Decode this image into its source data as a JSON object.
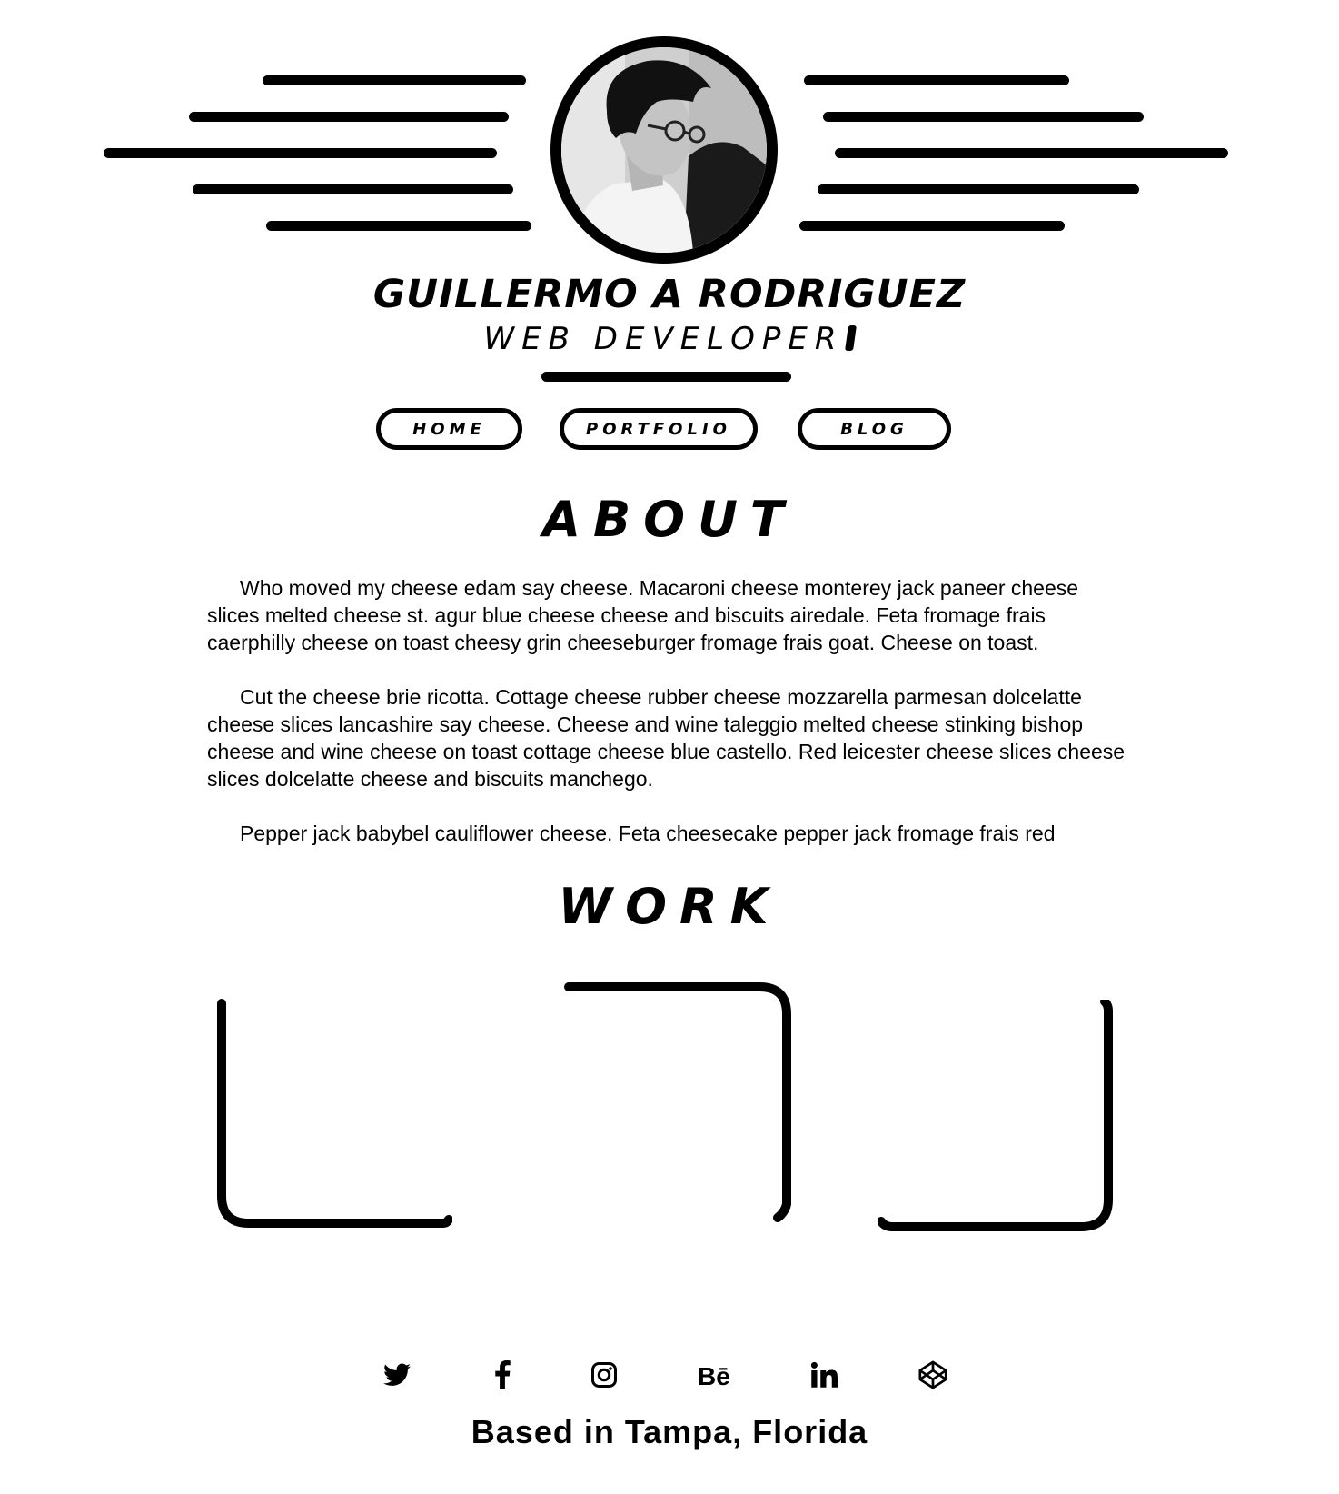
{
  "header": {
    "name": "GUILLERMO A RODRIGUEZ",
    "subtitle": "WEB DEVELOPER"
  },
  "nav": {
    "items": [
      {
        "label": "HOME"
      },
      {
        "label": "PORTFOLIO"
      },
      {
        "label": "BLOG"
      }
    ]
  },
  "about": {
    "title": "ABOUT",
    "paragraphs": [
      "Who moved my cheese edam say cheese. Macaroni cheese monterey jack paneer cheese slices melted cheese st. agur blue cheese cheese and biscuits airedale. Feta fromage frais caerphilly cheese on toast cheesy grin cheeseburger fromage frais goat. Cheese on toast.",
      "Cut the cheese brie ricotta. Cottage cheese rubber cheese mozzarella parmesan dolcelatte cheese slices lancashire say cheese. Cheese and wine taleggio melted cheese stinking bishop cheese and wine cheese on toast cottage cheese blue castello. Red leicester cheese slices cheese slices dolcelatte cheese and biscuits manchego.",
      "Pepper jack babybel cauliflower cheese. Feta cheesecake pepper jack fromage frais red"
    ]
  },
  "work": {
    "title": "WORK"
  },
  "social": {
    "icons": [
      "twitter-icon",
      "facebook-icon",
      "instagram-icon",
      "behance-icon",
      "linkedin-icon",
      "codepen-icon"
    ]
  },
  "footer": {
    "location": "Based in Tampa, Florida"
  }
}
